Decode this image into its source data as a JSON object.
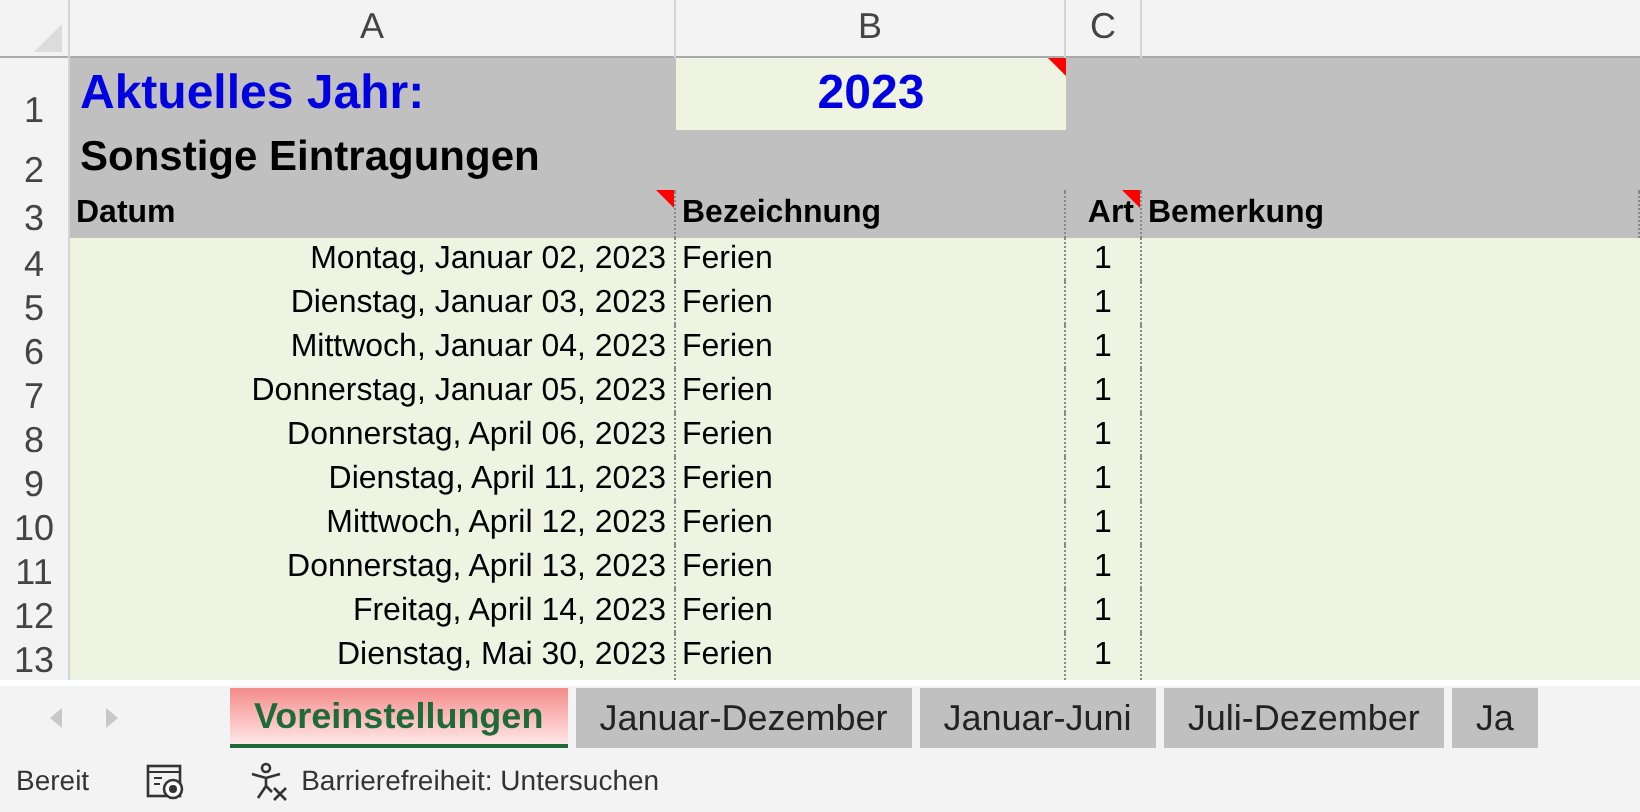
{
  "column_headers": [
    "A",
    "B",
    "C"
  ],
  "year_row": {
    "number": "1",
    "label": "Aktuelles Jahr:",
    "value": "2023",
    "value_comment": true
  },
  "section_row": {
    "number": "2",
    "title": "Sonstige Eintragungen"
  },
  "header_row": {
    "number": "3",
    "cells": [
      {
        "text": "Datum",
        "comment": true
      },
      {
        "text": "Bezeichnung",
        "comment": false
      },
      {
        "text": "Art",
        "comment": true
      },
      {
        "text": "Bemerkung",
        "comment": false
      }
    ]
  },
  "entries": [
    {
      "number": "4",
      "datum": "Montag, Januar 02, 2023",
      "bezeichnung": "Ferien",
      "art": "1"
    },
    {
      "number": "5",
      "datum": "Dienstag, Januar 03, 2023",
      "bezeichnung": "Ferien",
      "art": "1"
    },
    {
      "number": "6",
      "datum": "Mittwoch, Januar 04, 2023",
      "bezeichnung": "Ferien",
      "art": "1"
    },
    {
      "number": "7",
      "datum": "Donnerstag, Januar 05, 2023",
      "bezeichnung": "Ferien",
      "art": "1"
    },
    {
      "number": "8",
      "datum": "Donnerstag, April 06, 2023",
      "bezeichnung": "Ferien",
      "art": "1"
    },
    {
      "number": "9",
      "datum": "Dienstag, April 11, 2023",
      "bezeichnung": "Ferien",
      "art": "1"
    },
    {
      "number": "10",
      "datum": "Mittwoch, April 12, 2023",
      "bezeichnung": "Ferien",
      "art": "1"
    },
    {
      "number": "11",
      "datum": "Donnerstag, April 13, 2023",
      "bezeichnung": "Ferien",
      "art": "1"
    },
    {
      "number": "12",
      "datum": "Freitag, April 14, 2023",
      "bezeichnung": "Ferien",
      "art": "1"
    },
    {
      "number": "13",
      "datum": "Dienstag, Mai 30, 2023",
      "bezeichnung": "Ferien",
      "art": "1"
    }
  ],
  "sheet_tabs": [
    {
      "label": "Voreinstellungen",
      "selected": true
    },
    {
      "label": "Januar-Dezember",
      "selected": false
    },
    {
      "label": "Januar-Juni",
      "selected": false
    },
    {
      "label": "Juli-Dezember",
      "selected": false
    },
    {
      "label": "Ja",
      "selected": false
    }
  ],
  "status_bar": {
    "mode": "Bereit",
    "accessibility": "Barrierefreiheit: Untersuchen"
  }
}
